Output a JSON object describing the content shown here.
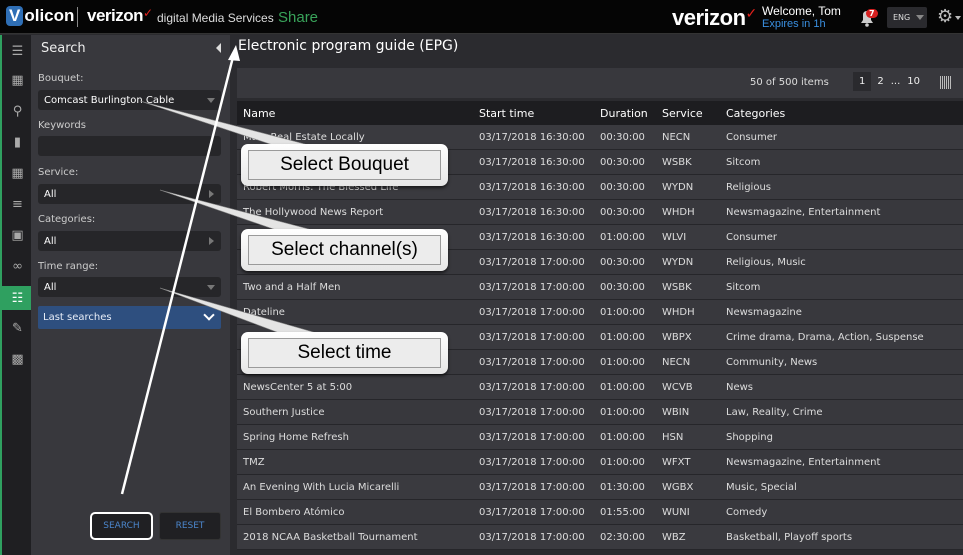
{
  "header": {
    "volicon_logo": "olicon",
    "volicon_logo_initial": "V",
    "verizon_logo": "verizon",
    "product": "digital Media Services",
    "module": "Share",
    "verizon_logo_right": "verizon",
    "welcome": "Welcome, Tom",
    "expires": "Expires in 1h",
    "notifications_count": "7",
    "language": "ENG"
  },
  "iconbar": {
    "items": [
      {
        "icon": "menu-icon",
        "glyph": "☰"
      },
      {
        "icon": "film-icon",
        "glyph": "▦"
      },
      {
        "icon": "search-icon",
        "glyph": "⚲"
      },
      {
        "icon": "bookmark-icon",
        "glyph": "▮"
      },
      {
        "icon": "grid-icon",
        "glyph": "▦"
      },
      {
        "icon": "list-icon",
        "glyph": "≡"
      },
      {
        "icon": "monitor-icon",
        "glyph": "▣"
      },
      {
        "icon": "voicemail-icon",
        "glyph": "∞"
      },
      {
        "icon": "epg-icon",
        "glyph": "☷",
        "active": true
      },
      {
        "icon": "document-edit-icon",
        "glyph": "✎"
      },
      {
        "icon": "image-icon",
        "glyph": "▩"
      }
    ]
  },
  "search_panel": {
    "title": "Search",
    "bouquet_label": "Bouquet:",
    "bouquet_value": "Comcast Burlington Cable",
    "keywords_label": "Keywords",
    "keywords_value": "",
    "service_label": "Service:",
    "service_value": "All",
    "categories_label": "Categories:",
    "categories_value": "All",
    "time_range_label": "Time range:",
    "time_range_value": "All",
    "last_searches": "Last searches",
    "search_button": "SEARCH",
    "reset_button": "RESET"
  },
  "main": {
    "title": "Electronic program guide (EPG)",
    "items_count": "50 of 500 items",
    "pages": [
      "1",
      "2",
      "...",
      "10"
    ],
    "columns": [
      "Name",
      "Start time",
      "Duration",
      "Service",
      "Categories"
    ],
    "rows": [
      {
        "name": "Ma...  Real Estate Locally",
        "start": "03/17/2018 16:30:00",
        "duration": "00:30:00",
        "service": "NECN",
        "categories": "Consumer"
      },
      {
        "name": "",
        "start": "03/17/2018 16:30:00",
        "duration": "00:30:00",
        "service": "WSBK",
        "categories": "Sitcom"
      },
      {
        "name": "Robert Morris: The Blessed Life",
        "start": "03/17/2018 16:30:00",
        "duration": "00:30:00",
        "service": "WYDN",
        "categories": "Religious"
      },
      {
        "name": "The Hollywood News Report",
        "start": "03/17/2018 16:30:00",
        "duration": "00:30:00",
        "service": "WHDH",
        "categories": "Newsmagazine, Entertainment"
      },
      {
        "name": "",
        "start": "03/17/2018 16:30:00",
        "duration": "01:00:00",
        "service": "WLVI",
        "categories": "Consumer"
      },
      {
        "name": "",
        "start": "03/17/2018 17:00:00",
        "duration": "00:30:00",
        "service": "WYDN",
        "categories": "Religious, Music"
      },
      {
        "name": "Two and a Half Men",
        "start": "03/17/2018 17:00:00",
        "duration": "00:30:00",
        "service": "WSBK",
        "categories": "Sitcom"
      },
      {
        "name": "Dateline",
        "start": "03/17/2018 17:00:00",
        "duration": "01:00:00",
        "service": "WHDH",
        "categories": "Newsmagazine"
      },
      {
        "name": "",
        "start": "03/17/2018 17:00:00",
        "duration": "01:00:00",
        "service": "WBPX",
        "categories": "Crime drama, Drama, Action, Suspense"
      },
      {
        "name": "",
        "start": "03/17/2018 17:00:00",
        "duration": "01:00:00",
        "service": "NECN",
        "categories": "Community, News"
      },
      {
        "name": "NewsCenter 5 at 5:00",
        "start": "03/17/2018 17:00:00",
        "duration": "01:00:00",
        "service": "WCVB",
        "categories": "News"
      },
      {
        "name": "Southern Justice",
        "start": "03/17/2018 17:00:00",
        "duration": "01:00:00",
        "service": "WBIN",
        "categories": "Law, Reality, Crime"
      },
      {
        "name": "Spring Home Refresh",
        "start": "03/17/2018 17:00:00",
        "duration": "01:00:00",
        "service": "HSN",
        "categories": "Shopping"
      },
      {
        "name": "TMZ",
        "start": "03/17/2018 17:00:00",
        "duration": "01:00:00",
        "service": "WFXT",
        "categories": "Newsmagazine, Entertainment"
      },
      {
        "name": "An Evening With Lucia Micarelli",
        "start": "03/17/2018 17:00:00",
        "duration": "01:30:00",
        "service": "WGBX",
        "categories": "Music, Special"
      },
      {
        "name": "El Bombero Atómico",
        "start": "03/17/2018 17:00:00",
        "duration": "01:55:00",
        "service": "WUNI",
        "categories": "Comedy"
      },
      {
        "name": "2018 NCAA Basketball Tournament",
        "start": "03/17/2018 17:00:00",
        "duration": "02:30:00",
        "service": "WBZ",
        "categories": "Basketball, Playoff sports"
      }
    ]
  },
  "annotations": {
    "callout_bouquet": "Select Bouquet",
    "callout_channels": "Select channel(s)",
    "callout_time": "Select time"
  }
}
